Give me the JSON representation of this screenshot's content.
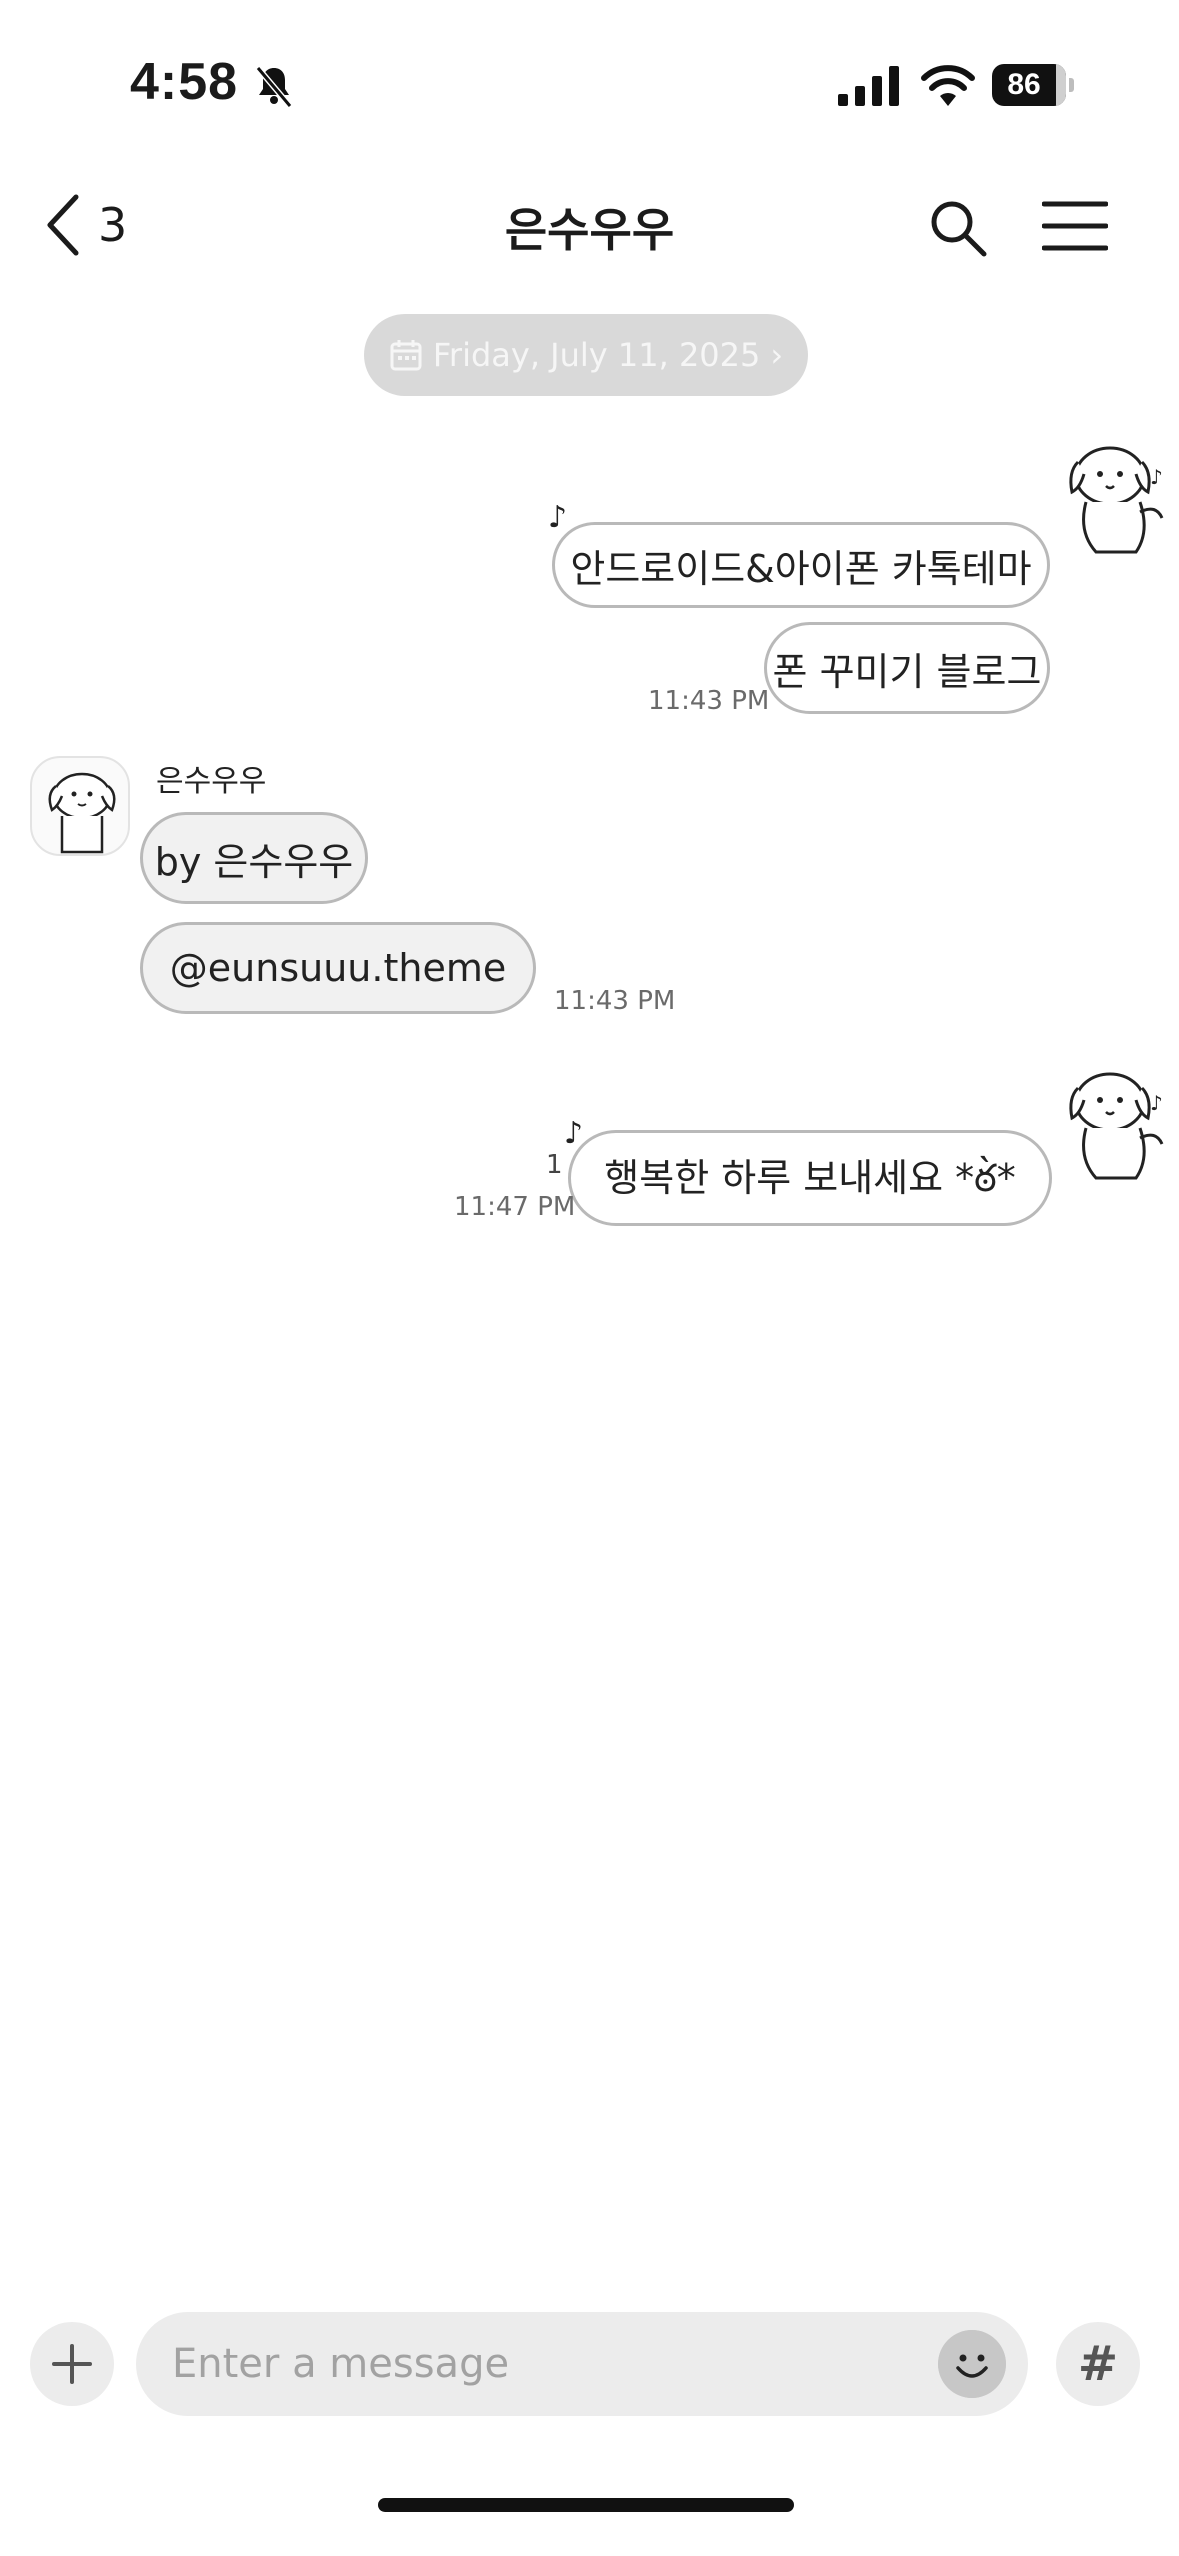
{
  "status": {
    "time": "4:58",
    "battery": "86"
  },
  "header": {
    "back_count": "3",
    "title": "은수우우"
  },
  "date_pill": {
    "label": "Friday, July 11, 2025"
  },
  "messages": [
    {
      "side": "sent",
      "text": "안드로이드&아이폰 카톡테마",
      "note": "♪"
    },
    {
      "side": "sent",
      "text": "폰 꾸미기 블로그",
      "time": "11:43 PM"
    },
    {
      "side": "received",
      "sender": "은수우우",
      "text": "by 은수우우"
    },
    {
      "side": "received",
      "text": "@eunsuuu.theme",
      "time": "11:43 PM"
    },
    {
      "side": "sent",
      "text": "행복한 하루 보내세요 *ఠ̀*",
      "time": "11:47 PM",
      "unread": "1",
      "note": "♪"
    }
  ],
  "composer": {
    "placeholder": "Enter a message",
    "hash_label": "#"
  },
  "icons": {
    "back": "chevron-left-icon",
    "search": "search-icon",
    "menu": "hamburger-icon",
    "calendar": "calendar-icon",
    "plus": "plus-icon",
    "emoji": "smiley-icon",
    "bell": "bell-slash-icon"
  }
}
